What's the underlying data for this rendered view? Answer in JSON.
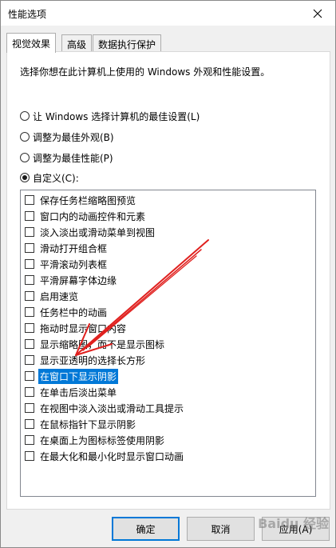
{
  "window": {
    "title": "性能选项"
  },
  "tabs": [
    {
      "label": "视觉效果"
    },
    {
      "label": "高级"
    },
    {
      "label": "数据执行保护"
    }
  ],
  "panel": {
    "description": "选择你想在此计算机上使用的 Windows 外观和性能设置。",
    "radios": [
      {
        "label": "让 Windows 选择计算机的最佳设置(L)",
        "checked": false
      },
      {
        "label": "调整为最佳外观(B)",
        "checked": false
      },
      {
        "label": "调整为最佳性能(P)",
        "checked": false
      },
      {
        "label": "自定义(C):",
        "checked": true
      }
    ],
    "options": [
      {
        "label": "保存任务栏缩略图预览",
        "checked": false
      },
      {
        "label": "窗口内的动画控件和元素",
        "checked": false
      },
      {
        "label": "淡入淡出或滑动菜单到视图",
        "checked": false
      },
      {
        "label": "滑动打开组合框",
        "checked": false
      },
      {
        "label": "平滑滚动列表框",
        "checked": false
      },
      {
        "label": "平滑屏幕字体边缘",
        "checked": false
      },
      {
        "label": "启用速览",
        "checked": false
      },
      {
        "label": "任务栏中的动画",
        "checked": false
      },
      {
        "label": "拖动时显示窗口内容",
        "checked": false
      },
      {
        "label": "显示缩略图，而不是显示图标",
        "checked": false
      },
      {
        "label": "显示亚透明的选择长方形",
        "checked": false
      },
      {
        "label": "在窗口下显示阴影",
        "checked": false,
        "selected": true
      },
      {
        "label": "在单击后淡出菜单",
        "checked": false
      },
      {
        "label": "在视图中淡入淡出或滑动工具提示",
        "checked": false
      },
      {
        "label": "在鼠标指针下显示阴影",
        "checked": false
      },
      {
        "label": "在桌面上为图标标签使用阴影",
        "checked": false
      },
      {
        "label": "在最大化和最小化时显示窗口动画",
        "checked": false
      }
    ]
  },
  "buttons": {
    "ok": "确定",
    "cancel": "取消",
    "apply": "应用(A)"
  },
  "watermark": "Baidu 经验",
  "colors": {
    "selection": "#0078d7",
    "arrow": "#e0201e"
  }
}
